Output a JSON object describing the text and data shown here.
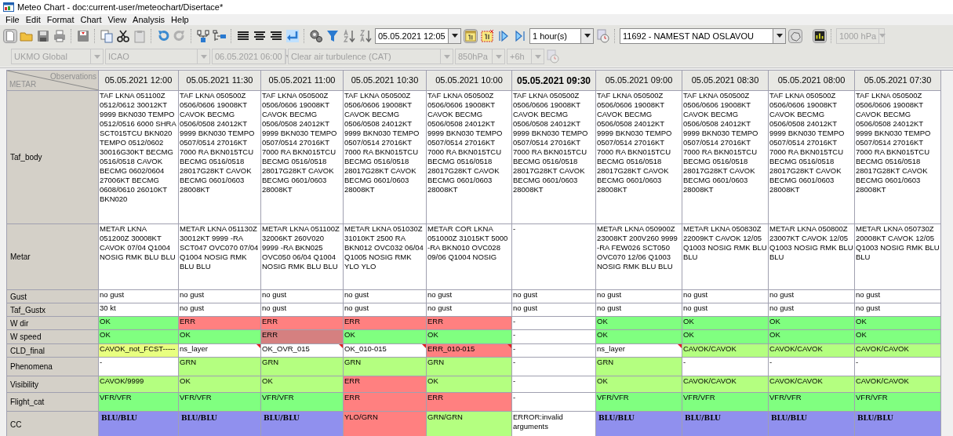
{
  "window": {
    "title": "Meteo Chart - doc:current-user/meteochart/Disertace*"
  },
  "menu": [
    "File",
    "Edit",
    "Format",
    "Chart",
    "View",
    "Analysis",
    "Help"
  ],
  "toolbar": {
    "datetime": "05.05.2021 12:05",
    "step": "1 hour(s)",
    "station": "11692 - NAMEST NAD OSLAVOU",
    "level": {
      "value": "1000 hPa",
      "disabled": true
    }
  },
  "filters": [
    {
      "value": "UKMO Global",
      "disabled": true
    },
    {
      "value": "ICAO",
      "disabled": true
    },
    {
      "value": "06.05.2021 06:00",
      "disabled": true
    },
    {
      "value": "Clear air turbulence (CAT)",
      "disabled": true
    },
    {
      "value": "850hPa",
      "disabled": true
    },
    {
      "value": "+6h",
      "disabled": true
    }
  ],
  "table": {
    "corner": {
      "top": "Observations",
      "bottom": "METAR"
    },
    "columns": [
      {
        "label": "05.05.2021 12:00",
        "selected": false
      },
      {
        "label": "05.05.2021 11:30",
        "selected": false
      },
      {
        "label": "05.05.2021 11:00",
        "selected": false
      },
      {
        "label": "05.05.2021 10:30",
        "selected": false
      },
      {
        "label": "05.05.2021 10:00",
        "selected": false
      },
      {
        "label": "05.05.2021 09:30",
        "selected": true
      },
      {
        "label": "05.05.2021 09:00",
        "selected": false
      },
      {
        "label": "05.05.2021 08:30",
        "selected": false
      },
      {
        "label": "05.05.2021 08:00",
        "selected": false
      },
      {
        "label": "05.05.2021 07:30",
        "selected": false
      }
    ],
    "rows": [
      {
        "label": "Taf_body",
        "cells": [
          {
            "text": "TAF LKNA 051100Z 0512/0612 30012KT 9999 BKN030 TEMPO 0512/0516 6000 SHRA SCT015TCU BKN020 TEMPO 0512/0602 30016G30KT BECMG 0516/0518 CAVOK BECMG 0602/0604 27006KT BECMG 0608/0610 26010KT BKN020",
            "color": "#ffffff"
          },
          {
            "text": "TAF LKNA 050500Z 0506/0606 19008KT CAVOK BECMG 0506/0508 24012KT 9999 BKN030 TEMPO 0507/0514 27016KT 7000 RA BKN015TCU BECMG 0516/0518 28017G28KT CAVOK BECMG 0601/0603 28008KT",
            "color": "#ffffff"
          },
          {
            "text": "TAF LKNA 050500Z 0506/0606 19008KT CAVOK BECMG 0506/0508 24012KT 9999 BKN030 TEMPO 0507/0514 27016KT 7000 RA BKN015TCU BECMG 0516/0518 28017G28KT CAVOK BECMG 0601/0603 28008KT",
            "color": "#ffffff"
          },
          {
            "text": "TAF LKNA 050500Z 0506/0606 19008KT CAVOK BECMG 0506/0508 24012KT 9999 BKN030 TEMPO 0507/0514 27016KT 7000 RA BKN015TCU BECMG 0516/0518 28017G28KT CAVOK BECMG 0601/0603 28008KT",
            "color": "#ffffff"
          },
          {
            "text": "TAF LKNA 050500Z 0506/0606 19008KT CAVOK BECMG 0506/0508 24012KT 9999 BKN030 TEMPO 0507/0514 27016KT 7000 RA BKN015TCU BECMG 0516/0518 28017G28KT CAVOK BECMG 0601/0603 28008KT",
            "color": "#ffffff"
          },
          {
            "text": "TAF LKNA 050500Z 0506/0606 19008KT CAVOK BECMG 0506/0508 24012KT 9999 BKN030 TEMPO 0507/0514 27016KT 7000 RA BKN015TCU BECMG 0516/0518 28017G28KT CAVOK BECMG 0601/0603 28008KT",
            "color": "#ffffff"
          },
          {
            "text": "TAF LKNA 050500Z 0506/0606 19008KT CAVOK BECMG 0506/0508 24012KT 9999 BKN030 TEMPO 0507/0514 27016KT 7000 RA BKN015TCU BECMG 0516/0518 28017G28KT CAVOK BECMG 0601/0603 28008KT",
            "color": "#ffffff"
          },
          {
            "text": "TAF LKNA 050500Z 0506/0606 19008KT CAVOK BECMG 0506/0508 24012KT 9999 BKN030 TEMPO 0507/0514 27016KT 7000 RA BKN015TCU BECMG 0516/0518 28017G28KT CAVOK BECMG 0601/0603 28008KT",
            "color": "#ffffff"
          },
          {
            "text": "TAF LKNA 050500Z 0506/0606 19008KT CAVOK BECMG 0506/0508 24012KT 9999 BKN030 TEMPO 0507/0514 27016KT 7000 RA BKN015TCU BECMG 0516/0518 28017G28KT CAVOK BECMG 0601/0603 28008KT",
            "color": "#ffffff"
          },
          {
            "text": "TAF LKNA 050500Z 0506/0606 19008KT CAVOK BECMG 0506/0508 24012KT 9999 BKN030 TEMPO 0507/0514 27016KT 7000 RA BKN015TCU BECMG 0516/0518 28017G28KT CAVOK BECMG 0601/0603 28008KT",
            "color": "#ffffff"
          }
        ]
      },
      {
        "label": "Metar",
        "cells": [
          {
            "text": "METAR LKNA 051200Z 30008KT CAVOK 07/04 Q1004 NOSIG RMK BLU BLU",
            "color": "#ffffff"
          },
          {
            "text": "METAR LKNA 051130Z 30012KT 9999 -RA SCT047 OVC070 07/04 Q1004 NOSIG RMK BLU BLU",
            "color": "#ffffff"
          },
          {
            "text": "METAR LKNA 051100Z 32006KT 260V020 9999 -RA BKN025 OVC050 06/04 Q1004 NOSIG RMK BLU BLU",
            "color": "#ffffff"
          },
          {
            "text": "METAR LKNA 051030Z 31010KT 2500 RA BKN012 OVC032 06/04 Q1005 NOSIG RMK YLO YLO",
            "color": "#ffffff"
          },
          {
            "text": "METAR COR LKNA 051000Z 31015KT 5000 -RA BKN010 OVC028 09/06 Q1004 NOSIG",
            "color": "#ffffff"
          },
          {
            "text": "-",
            "color": "#ffffff"
          },
          {
            "text": "METAR LKNA 050900Z 23008KT 200V260 9999 -RA FEW026 SCT050 OVC070 12/06 Q1003 NOSIG RMK BLU BLU",
            "color": "#ffffff"
          },
          {
            "text": "METAR LKNA 050830Z 22009KT CAVOK 12/05 Q1003 NOSIG RMK BLU BLU",
            "color": "#ffffff"
          },
          {
            "text": "METAR LKNA 050800Z 23007KT CAVOK 12/05 Q1003 NOSIG RMK BLU BLU",
            "color": "#ffffff"
          },
          {
            "text": "METAR LKNA 050730Z 20008KT CAVOK 12/05 Q1003 NOSIG RMK BLU BLU",
            "color": "#ffffff"
          }
        ]
      },
      {
        "label": "Gust",
        "cells": [
          {
            "text": "no gust",
            "color": "#ffffff"
          },
          {
            "text": "no gust",
            "color": "#ffffff"
          },
          {
            "text": "no gust",
            "color": "#ffffff"
          },
          {
            "text": "no gust",
            "color": "#ffffff"
          },
          {
            "text": "no gust",
            "color": "#ffffff"
          },
          {
            "text": "no gust",
            "color": "#ffffff"
          },
          {
            "text": "no gust",
            "color": "#ffffff"
          },
          {
            "text": "no gust",
            "color": "#ffffff"
          },
          {
            "text": "no gust",
            "color": "#ffffff"
          },
          {
            "text": "no gust",
            "color": "#ffffff"
          }
        ]
      },
      {
        "label": "Taf_Gustx",
        "cells": [
          {
            "text": "30 kt",
            "color": "#ffffff"
          },
          {
            "text": "no gust",
            "color": "#ffffff"
          },
          {
            "text": "no gust",
            "color": "#ffffff"
          },
          {
            "text": "no gust",
            "color": "#ffffff"
          },
          {
            "text": "no gust",
            "color": "#ffffff"
          },
          {
            "text": "no gust",
            "color": "#ffffff"
          },
          {
            "text": "no gust",
            "color": "#ffffff"
          },
          {
            "text": "no gust",
            "color": "#ffffff"
          },
          {
            "text": "no gust",
            "color": "#ffffff"
          },
          {
            "text": "no gust",
            "color": "#ffffff"
          }
        ]
      },
      {
        "label": "W dir",
        "cells": [
          {
            "text": "OK",
            "color": "#80ff80"
          },
          {
            "text": "ERR",
            "color": "#ff8080"
          },
          {
            "text": "ERR",
            "color": "#ff8080"
          },
          {
            "text": "ERR",
            "color": "#ff8080"
          },
          {
            "text": "ERR",
            "color": "#ff8080"
          },
          {
            "text": "-",
            "color": "#ffffff"
          },
          {
            "text": "OK",
            "color": "#80ff80"
          },
          {
            "text": "OK",
            "color": "#80ff80"
          },
          {
            "text": "OK",
            "color": "#80ff80"
          },
          {
            "text": "OK",
            "color": "#80ff80"
          }
        ]
      },
      {
        "label": "W speed",
        "cells": [
          {
            "text": "OK",
            "color": "#80ff80"
          },
          {
            "text": "OK",
            "color": "#80ff80"
          },
          {
            "text": "ERR",
            "color": "#d58080"
          },
          {
            "text": "OK",
            "color": "#80ff80"
          },
          {
            "text": "OK",
            "color": "#80ff80"
          },
          {
            "text": "-",
            "color": "#ffffff"
          },
          {
            "text": "OK",
            "color": "#80ff80"
          },
          {
            "text": "OK",
            "color": "#80ff80"
          },
          {
            "text": "OK",
            "color": "#80ff80"
          },
          {
            "text": "OK",
            "color": "#80ff80"
          }
        ]
      },
      {
        "label": "CLD_final",
        "cells": [
          {
            "text": "CAVOK_not_FCST-------",
            "color": "#e8ff80",
            "flagged": false
          },
          {
            "text": "ns_layer",
            "color": "#ffffff",
            "flagged": true
          },
          {
            "text": "OK_OVR_015",
            "color": "#ffffff",
            "flagged": true
          },
          {
            "text": "OK_010-015",
            "color": "#ffffff",
            "flagged": true
          },
          {
            "text": "ERR_010-015",
            "color": "#ff8080",
            "flagged": true
          },
          {
            "text": "-",
            "color": "#ffffff",
            "flagged": false
          },
          {
            "text": "ns_layer",
            "color": "#ffffff",
            "flagged": true
          },
          {
            "text": "CAVOK/CAVOK",
            "color": "#b4ff80",
            "flagged": false
          },
          {
            "text": "CAVOK/CAVOK",
            "color": "#b4ff80",
            "flagged": false
          },
          {
            "text": "CAVOK/CAVOK",
            "color": "#b4ff80",
            "flagged": false
          }
        ]
      },
      {
        "label": "Phenomena",
        "cells": [
          {
            "text": "-",
            "color": "#ffffff"
          },
          {
            "text": "GRN",
            "color": "#b4ff80"
          },
          {
            "text": "GRN",
            "color": "#b4ff80"
          },
          {
            "text": "GRN",
            "color": "#b4ff80"
          },
          {
            "text": "GRN",
            "color": "#b4ff80"
          },
          {
            "text": "-",
            "color": "#ffffff"
          },
          {
            "text": "GRN",
            "color": "#b4ff80"
          },
          {
            "text": "-",
            "color": "#ffffff"
          },
          {
            "text": "-",
            "color": "#ffffff"
          },
          {
            "text": "-",
            "color": "#ffffff"
          }
        ]
      },
      {
        "label": "Visibility",
        "cells": [
          {
            "text": "CAVOK/9999",
            "color": "#b4ff80"
          },
          {
            "text": "OK",
            "color": "#b4ff80"
          },
          {
            "text": "OK",
            "color": "#b4ff80"
          },
          {
            "text": "ERR",
            "color": "#ff8080"
          },
          {
            "text": "OK",
            "color": "#b4ff80"
          },
          {
            "text": "-",
            "color": "#ffffff"
          },
          {
            "text": "OK",
            "color": "#b4ff80"
          },
          {
            "text": "CAVOK/CAVOK",
            "color": "#b4ff80"
          },
          {
            "text": "CAVOK/CAVOK",
            "color": "#b4ff80"
          },
          {
            "text": "CAVOK/CAVOK",
            "color": "#b4ff80"
          }
        ]
      },
      {
        "label": "Flight_cat",
        "cells": [
          {
            "text": "VFR/VFR",
            "color": "#80ff80"
          },
          {
            "text": "VFR/VFR",
            "color": "#80ff80"
          },
          {
            "text": "VFR/VFR",
            "color": "#80ff80"
          },
          {
            "text": "ERR",
            "color": "#ff8080"
          },
          {
            "text": "ERR",
            "color": "#ff8080"
          },
          {
            "text": "-",
            "color": "#ffffff"
          },
          {
            "text": "VFR/VFR",
            "color": "#80ff80"
          },
          {
            "text": "VFR/VFR",
            "color": "#80ff80"
          },
          {
            "text": "VFR/VFR",
            "color": "#80ff80"
          },
          {
            "text": "VFR/VFR",
            "color": "#80ff80"
          }
        ]
      },
      {
        "label": "CC",
        "cells": [
          {
            "text": "BLU/BLU",
            "color": "#9090ee",
            "kind": "rendered"
          },
          {
            "text": "BLU/BLU",
            "color": "#9090ee",
            "kind": "rendered"
          },
          {
            "text": "BLU/BLU",
            "color": "#9090ee",
            "kind": "rendered"
          },
          {
            "text": "YLO/GRN",
            "color": "#ff8080",
            "kind": "plain"
          },
          {
            "text": "GRN/GRN",
            "color": "#b4ff80",
            "kind": "plain"
          },
          {
            "text": "ERROR:invalid arguments",
            "color": "#ffffff",
            "kind": "plain"
          },
          {
            "text": "BLU/BLU",
            "color": "#9090ee",
            "kind": "rendered"
          },
          {
            "text": "BLU/BLU",
            "color": "#9090ee",
            "kind": "rendered"
          },
          {
            "text": "BLU/BLU",
            "color": "#9090ee",
            "kind": "rendered"
          },
          {
            "text": "BLU/BLU",
            "color": "#9090ee",
            "kind": "rendered"
          }
        ]
      }
    ]
  }
}
